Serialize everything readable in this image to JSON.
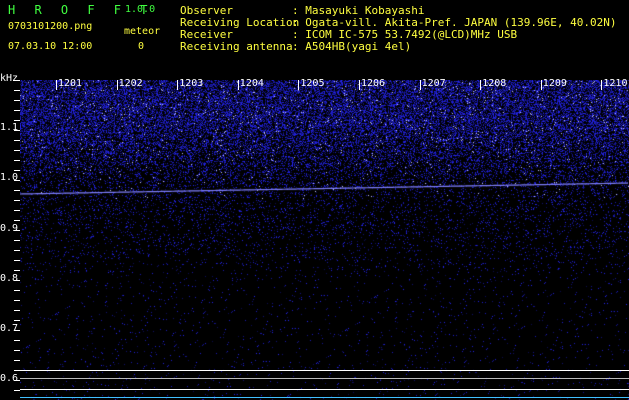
{
  "header": {
    "app_name": "H R O F F T",
    "version": "1.0.0",
    "filename": "0703101200.png",
    "datetime": "07.03.10 12:00",
    "meteor_label": "meteor",
    "meteor_count": "0"
  },
  "info": {
    "observer_label": "Observer",
    "observer_value": ": Masayuki Kobayashi",
    "location_label": "Receiving Location",
    "location_value": ": Ogata-vill. Akita-Pref. JAPAN (139.96E, 40.02N)",
    "receiver_label": "Receiver",
    "receiver_value": ": ICOM IC-575 53.7492(@LCD)MHz USB",
    "antenna_label": "Receiving antenna",
    "antenna_value": ": A504HB(yagi 4el)"
  },
  "spectrogram": {
    "y_unit": "kHz",
    "y_ticks": [
      "1.1",
      "1.0",
      "0.9",
      "0.8",
      "0.7",
      "0.6"
    ],
    "x_ticks": [
      "1201",
      "1202",
      "1203",
      "1204",
      "1205",
      "1206",
      "1207",
      "1208",
      "1209",
      "1210"
    ],
    "colors": {
      "signal": "#2a2aff",
      "bright": "#c8c8ff",
      "carrier": "#8080ff",
      "axis": "#ffffff"
    }
  }
}
